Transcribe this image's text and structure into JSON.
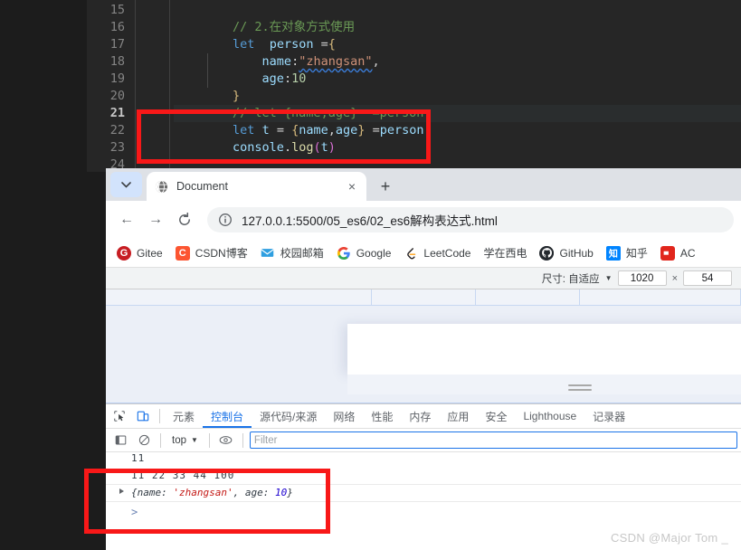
{
  "editor": {
    "line_numbers": [
      "15",
      "16",
      "17",
      "18",
      "19",
      "20",
      "21",
      "22",
      "23",
      "24"
    ],
    "active_line": "21",
    "lines": [
      {
        "n": "15",
        "tokens": []
      },
      {
        "n": "16",
        "tokens": [
          {
            "t": "        ",
            "c": "plain"
          },
          {
            "t": "// 2.在对象方式使用",
            "c": "comment"
          }
        ]
      },
      {
        "n": "17",
        "tokens": [
          {
            "t": "        ",
            "c": "plain"
          },
          {
            "t": "let",
            "c": "kw"
          },
          {
            "t": "  ",
            "c": "plain"
          },
          {
            "t": "person",
            "c": "var"
          },
          {
            "t": " ",
            "c": "plain"
          },
          {
            "t": "=",
            "c": "op"
          },
          {
            "t": "{",
            "c": "brace"
          }
        ]
      },
      {
        "n": "18",
        "tokens": [
          {
            "t": "            ",
            "c": "plain"
          },
          {
            "t": "name",
            "c": "var"
          },
          {
            "t": ":",
            "c": "op"
          },
          {
            "t": "\"zhangsan\"",
            "c": "str"
          },
          {
            "t": ",",
            "c": "op"
          }
        ]
      },
      {
        "n": "19",
        "tokens": [
          {
            "t": "            ",
            "c": "plain"
          },
          {
            "t": "age",
            "c": "var"
          },
          {
            "t": ":",
            "c": "op"
          },
          {
            "t": "10",
            "c": "num"
          }
        ]
      },
      {
        "n": "20",
        "tokens": [
          {
            "t": "        ",
            "c": "plain"
          },
          {
            "t": "}",
            "c": "brace"
          }
        ]
      },
      {
        "n": "21",
        "tokens": [
          {
            "t": "        ",
            "c": "plain"
          },
          {
            "t": "// let {name,age}  =person",
            "c": "comment"
          }
        ]
      },
      {
        "n": "22",
        "tokens": [
          {
            "t": "        ",
            "c": "plain"
          },
          {
            "t": "let",
            "c": "kw"
          },
          {
            "t": " ",
            "c": "plain"
          },
          {
            "t": "t",
            "c": "var"
          },
          {
            "t": " ",
            "c": "plain"
          },
          {
            "t": "=",
            "c": "op"
          },
          {
            "t": " ",
            "c": "plain"
          },
          {
            "t": "{",
            "c": "brace"
          },
          {
            "t": "name",
            "c": "var"
          },
          {
            "t": ",",
            "c": "op"
          },
          {
            "t": "age",
            "c": "var"
          },
          {
            "t": "}",
            "c": "brace"
          },
          {
            "t": " ",
            "c": "plain"
          },
          {
            "t": "=",
            "c": "op"
          },
          {
            "t": "person",
            "c": "var"
          }
        ]
      },
      {
        "n": "23",
        "tokens": [
          {
            "t": "        ",
            "c": "plain"
          },
          {
            "t": "console",
            "c": "var"
          },
          {
            "t": ".",
            "c": "op"
          },
          {
            "t": "log",
            "c": "fn"
          },
          {
            "t": "(",
            "c": "paren"
          },
          {
            "t": "t",
            "c": "var"
          },
          {
            "t": ")",
            "c": "paren"
          }
        ]
      },
      {
        "n": "24",
        "tokens": []
      }
    ]
  },
  "browser": {
    "tab_list_button": "tab-search-icon",
    "tab": {
      "title": "Document",
      "favicon": "globe-icon",
      "close": "×"
    },
    "new_tab": "+",
    "toolbar": {
      "back": "←",
      "forward": "→",
      "reload": "⟳",
      "site_info_icon": "info-circle-icon",
      "url": "127.0.0.1:5500/05_es6/02_es6解构表达式.html"
    },
    "bookmarks": [
      {
        "label": "Gitee",
        "icon": "gitee-icon",
        "fg": "#ffffff",
        "bg": "#c71d23",
        "glyph": "G"
      },
      {
        "label": "CSDN博客",
        "icon": "csdn-icon",
        "fg": "#ffffff",
        "bg": "#fc5531",
        "glyph": "C"
      },
      {
        "label": "校园邮箱",
        "icon": "mail-icon",
        "fg": "#ffffff",
        "bg": "#2f9fe0",
        "glyph": "✉"
      },
      {
        "label": "Google",
        "icon": "google-icon",
        "fg": "#4285f4",
        "bg": "#ffffff",
        "glyph": "G"
      },
      {
        "label": "LeetCode",
        "icon": "leetcode-icon",
        "fg": "#ffa116",
        "bg": "#ffffff",
        "glyph": "ᘓ"
      },
      {
        "label": "学在西电",
        "icon": "blank-icon",
        "fg": "#3c4043",
        "bg": "#ffffff",
        "glyph": ""
      },
      {
        "label": "GitHub",
        "icon": "github-icon",
        "fg": "#ffffff",
        "bg": "#24292e",
        "glyph": ""
      },
      {
        "label": "知乎",
        "icon": "zhihu-icon",
        "fg": "#ffffff",
        "bg": "#0084ff",
        "glyph": "知"
      },
      {
        "label": "AC",
        "icon": "acwing-icon",
        "fg": "#ffffff",
        "bg": "#e1261c",
        "glyph": ""
      }
    ],
    "device_bar": {
      "size_label": "尺寸: 自适应",
      "caret": "▼",
      "width": "1020",
      "times": "×",
      "height": "54"
    }
  },
  "devtools": {
    "inspect_icon": "inspect-element-icon",
    "device_icon": "device-toolbar-icon",
    "tabs": [
      {
        "label": "元素",
        "active": false
      },
      {
        "label": "控制台",
        "active": true
      },
      {
        "label": "源代码/来源",
        "active": false
      },
      {
        "label": "网络",
        "active": false
      },
      {
        "label": "性能",
        "active": false
      },
      {
        "label": "内存",
        "active": false
      },
      {
        "label": "应用",
        "active": false
      },
      {
        "label": "安全",
        "active": false
      },
      {
        "label": "Lighthouse",
        "active": false
      },
      {
        "label": "记录器",
        "active": false
      }
    ],
    "console_toolbar": {
      "sidebar_icon": "console-sidebar-icon",
      "clear_icon": "clear-console-icon",
      "context": "top",
      "context_caret": "▼",
      "eye_icon": "live-expression-icon",
      "filter_placeholder": "Filter"
    },
    "console_output": {
      "line_partial": "11",
      "log_numbers": "11 22 33 44 100",
      "object_open": "{",
      "object_key1": "name: ",
      "object_val1": "'zhangsan'",
      "object_sep": ", ",
      "object_key2": "age: ",
      "object_val2": "10",
      "object_close": "}",
      "prompt": ">"
    }
  },
  "annotations": {
    "highlight_color": "#f81818",
    "code_box": "red-highlight-code",
    "console_box": "red-highlight-console"
  },
  "watermark": "CSDN @Major Tom _"
}
